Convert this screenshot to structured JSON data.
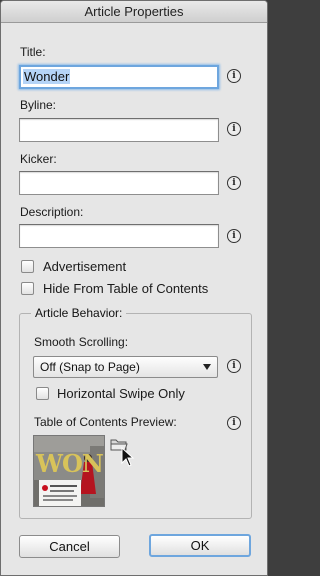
{
  "dialog": {
    "title": "Article Properties"
  },
  "fields": {
    "title": {
      "label": "Title:",
      "value": "Wonder"
    },
    "byline": {
      "label": "Byline:",
      "value": ""
    },
    "kicker": {
      "label": "Kicker:",
      "value": ""
    },
    "description": {
      "label": "Description:",
      "value": ""
    }
  },
  "checkboxes": {
    "advertisement": {
      "label": "Advertisement",
      "checked": false
    },
    "hide_toc": {
      "label": "Hide From Table of Contents",
      "checked": false
    }
  },
  "behavior": {
    "group_label": "Article Behavior:",
    "smooth_scrolling_label": "Smooth Scrolling:",
    "smooth_scrolling_value": "Off (Snap to Page)",
    "horizontal_swipe_label": "Horizontal Swipe Only",
    "horizontal_swipe_checked": false,
    "toc_preview_label": "Table of Contents Preview:",
    "preview_text": "WON"
  },
  "icons": {
    "info": "info-icon",
    "folder": "folder-icon",
    "cursor": "pointer-cursor-icon"
  },
  "buttons": {
    "cancel": "Cancel",
    "ok": "OK"
  },
  "colors": {
    "focus_ring": "#6ea6de",
    "selection": "#b5d4f7",
    "preview_accent": "#c8101e",
    "preview_title": "#d8c35a"
  }
}
